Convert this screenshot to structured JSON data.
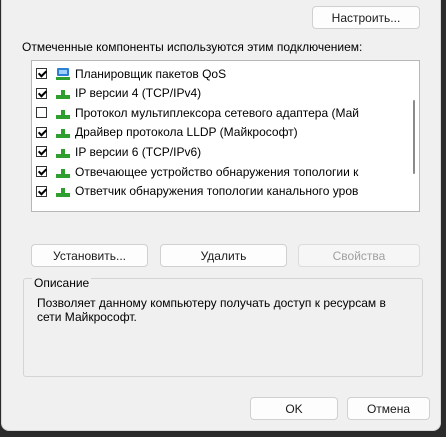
{
  "buttons": {
    "configure": "Настроить...",
    "install": "Установить...",
    "remove": "Удалить",
    "properties": "Свойства",
    "ok": "OK",
    "cancel": "Отмена"
  },
  "components_label": "Отмеченные компоненты используются этим подключением:",
  "components": [
    {
      "label": "Планировщик пакетов QoS",
      "checked": true,
      "icon": "network-scheduler-icon"
    },
    {
      "label": "IP версии 4 (TCP/IPv4)",
      "checked": true,
      "icon": "network-protocol-icon"
    },
    {
      "label": "Протокол мультиплексора сетевого адаптера (Май",
      "checked": false,
      "icon": "network-protocol-icon"
    },
    {
      "label": "Драйвер протокола LLDP (Майкрософт)",
      "checked": true,
      "icon": "network-protocol-icon"
    },
    {
      "label": "IP версии 6 (TCP/IPv6)",
      "checked": true,
      "icon": "network-protocol-icon"
    },
    {
      "label": "Отвечающее устройство обнаружения топологии к",
      "checked": true,
      "icon": "network-protocol-icon"
    },
    {
      "label": "Ответчик обнаружения топологии канального уров",
      "checked": true,
      "icon": "network-protocol-icon"
    }
  ],
  "description": {
    "title": "Описание",
    "text": "Позволяет данному компьютеру получать доступ к ресурсам в сети Майкрософт."
  },
  "colors": {
    "focus_border": "#1d5fb8",
    "icon_green": "#2e9e2e",
    "icon_blue": "#2d7fd3"
  }
}
